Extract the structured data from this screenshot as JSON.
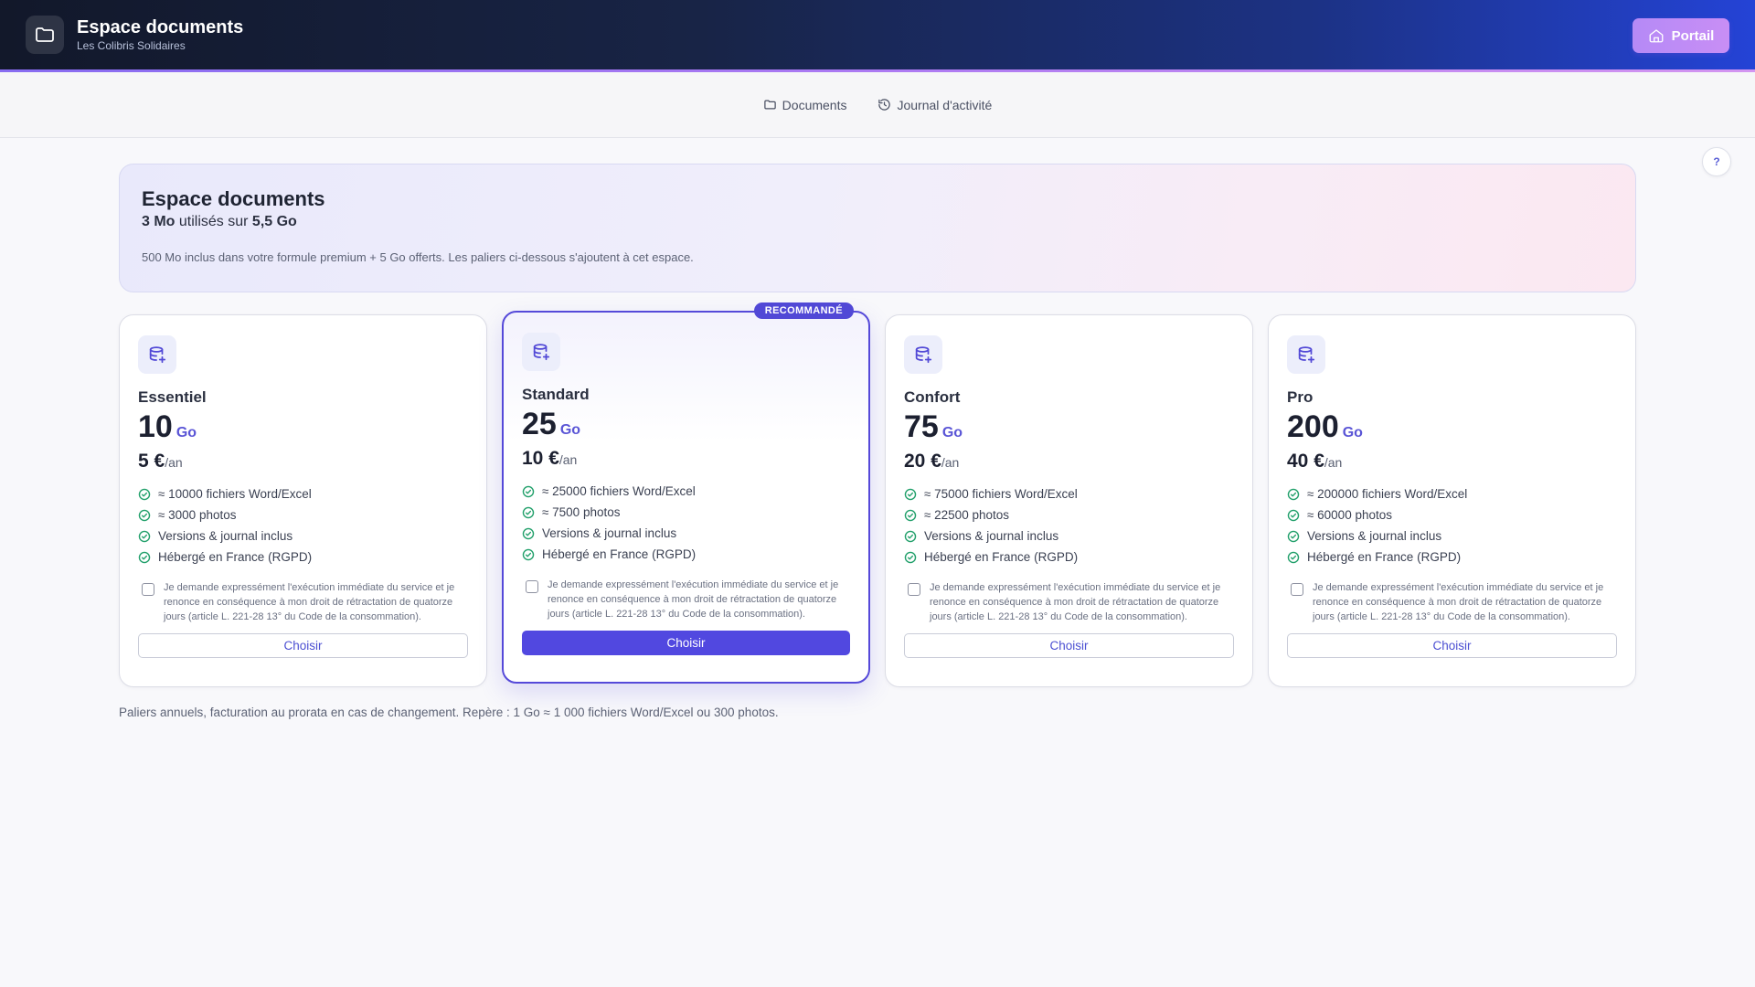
{
  "header": {
    "title": "Espace documents",
    "subtitle": "Les Colibris Solidaires",
    "portal_label": "Portail"
  },
  "nav": {
    "items": [
      {
        "label": "Documents",
        "icon": "folder-icon"
      },
      {
        "label": "Journal d'activité",
        "icon": "history-icon"
      }
    ]
  },
  "help": {
    "label": "?"
  },
  "banner": {
    "title": "Espace documents",
    "used": "3 Mo",
    "used_text": " utilisés sur ",
    "total": "5,5 Go",
    "note": "500 Mo inclus dans votre formule premium + 5 Go offerts. Les paliers ci-dessous s'ajoutent à cet espace."
  },
  "tiers": [
    {
      "name": "Essentiel",
      "size": "10",
      "unit": "Go",
      "price": "5 €",
      "period": "/an",
      "features": [
        "≈ 10000 fichiers Word/Excel",
        "≈ 3000 photos",
        "Versions & journal inclus",
        "Hébergé en France (RGPD)"
      ],
      "consent": "Je demande expressément l'exécution immédiate du service et je renonce en conséquence à mon droit de rétractation de quatorze jours (article L. 221-28 13° du Code de la consommation).",
      "button": "Choisir"
    },
    {
      "name": "Standard",
      "size": "25",
      "unit": "Go",
      "price": "10 €",
      "period": "/an",
      "badge": "RECOMMANDÉ",
      "features": [
        "≈ 25000 fichiers Word/Excel",
        "≈ 7500 photos",
        "Versions & journal inclus",
        "Hébergé en France (RGPD)"
      ],
      "consent": "Je demande expressément l'exécution immédiate du service et je renonce en conséquence à mon droit de rétractation de quatorze jours (article L. 221-28 13° du Code de la consommation).",
      "button": "Choisir"
    },
    {
      "name": "Confort",
      "size": "75",
      "unit": "Go",
      "price": "20 €",
      "period": "/an",
      "features": [
        "≈ 75000 fichiers Word/Excel",
        "≈ 22500 photos",
        "Versions & journal inclus",
        "Hébergé en France (RGPD)"
      ],
      "consent": "Je demande expressément l'exécution immédiate du service et je renonce en conséquence à mon droit de rétractation de quatorze jours (article L. 221-28 13° du Code de la consommation).",
      "button": "Choisir"
    },
    {
      "name": "Pro",
      "size": "200",
      "unit": "Go",
      "price": "40 €",
      "period": "/an",
      "features": [
        "≈ 200000 fichiers Word/Excel",
        "≈ 60000 photos",
        "Versions & journal inclus",
        "Hébergé en France (RGPD)"
      ],
      "consent": "Je demande expressément l'exécution immédiate du service et je renonce en conséquence à mon droit de rétractation de quatorze jours (article L. 221-28 13° du Code de la consommation).",
      "button": "Choisir"
    }
  ],
  "footer": {
    "note": "Paliers annuels, facturation au prorata en cas de changement. Repère : 1 Go ≈ 1 000 fichiers Word/Excel ou 300 photos."
  },
  "colors": {
    "accent": "#5148d6",
    "check": "#22a06b",
    "header_dark": "#12182a",
    "header_blue": "#2443d6"
  }
}
